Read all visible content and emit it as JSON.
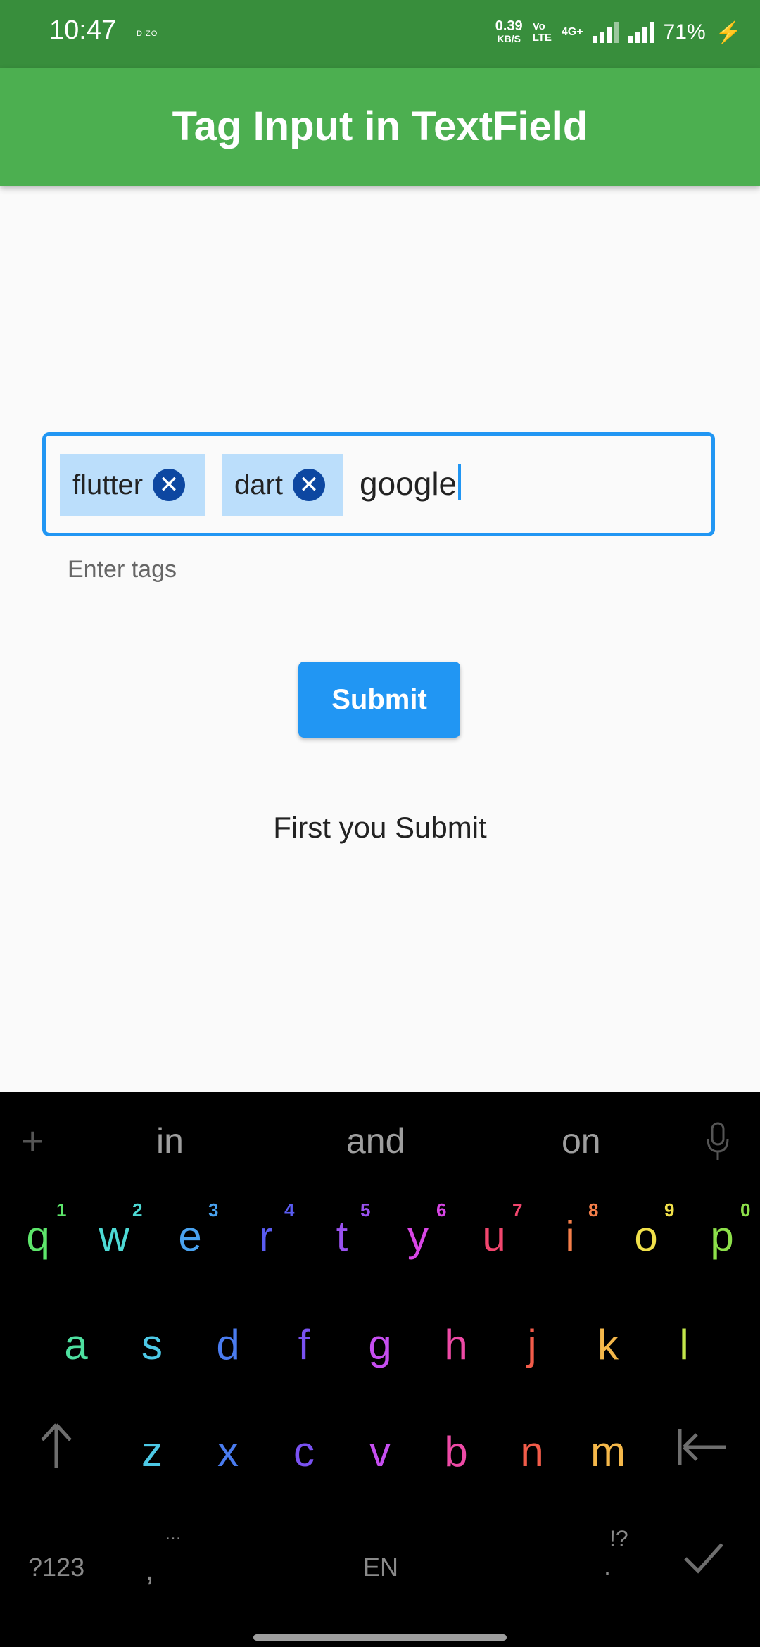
{
  "status_bar": {
    "time": "10:47",
    "brand": "DIZO",
    "net_speed": "0.39",
    "net_unit": "KB/S",
    "volte_top": "Vo",
    "volte_bottom": "LTE",
    "network": "4G+",
    "battery": "71%"
  },
  "app_bar": {
    "title": "Tag Input in TextField",
    "color": "#4caf50"
  },
  "tag_field": {
    "tags": [
      {
        "label": "flutter"
      },
      {
        "label": "dart"
      }
    ],
    "typed_value": "google",
    "helper_text": "Enter tags",
    "border_color": "#2196f3",
    "chip_color": "#bbdefb"
  },
  "submit": {
    "label": "Submit",
    "color": "#2196f3"
  },
  "result_text": "First you Submit",
  "keyboard": {
    "suggestions": [
      "in",
      "and",
      "on"
    ],
    "row1": [
      {
        "k": "q",
        "n": "1",
        "c": "#5de66b"
      },
      {
        "k": "w",
        "n": "2",
        "c": "#4dd9d4"
      },
      {
        "k": "e",
        "n": "3",
        "c": "#4aa3f0"
      },
      {
        "k": "r",
        "n": "4",
        "c": "#5a5cf2"
      },
      {
        "k": "t",
        "n": "5",
        "c": "#9a52f0"
      },
      {
        "k": "y",
        "n": "6",
        "c": "#d946e6"
      },
      {
        "k": "u",
        "n": "7",
        "c": "#f2466e"
      },
      {
        "k": "i",
        "n": "8",
        "c": "#f57f4a"
      },
      {
        "k": "o",
        "n": "9",
        "c": "#f0e04a"
      },
      {
        "k": "p",
        "n": "0",
        "c": "#8de04a"
      }
    ],
    "row2": [
      {
        "k": "a",
        "c": "#4ee0a0"
      },
      {
        "k": "s",
        "c": "#4dc9e6"
      },
      {
        "k": "d",
        "c": "#4a7cf0"
      },
      {
        "k": "f",
        "c": "#7a52f2"
      },
      {
        "k": "g",
        "c": "#c64ef0"
      },
      {
        "k": "h",
        "c": "#ee4aa6"
      },
      {
        "k": "j",
        "c": "#f25c4a"
      },
      {
        "k": "k",
        "c": "#f5b84a"
      },
      {
        "k": "l",
        "c": "#c2e64a"
      }
    ],
    "row3": [
      {
        "k": "z",
        "c": "#4dc9e6"
      },
      {
        "k": "x",
        "c": "#4a7cf0"
      },
      {
        "k": "c",
        "c": "#7a52f2"
      },
      {
        "k": "v",
        "c": "#c64ef0"
      },
      {
        "k": "b",
        "c": "#ee4aa6"
      },
      {
        "k": "n",
        "c": "#f25c4a"
      },
      {
        "k": "m",
        "c": "#f5b84a"
      }
    ],
    "symbols_key": "?123",
    "comma_key": ",",
    "language_key": "EN",
    "punct_key": "!?",
    "period_key": "."
  }
}
